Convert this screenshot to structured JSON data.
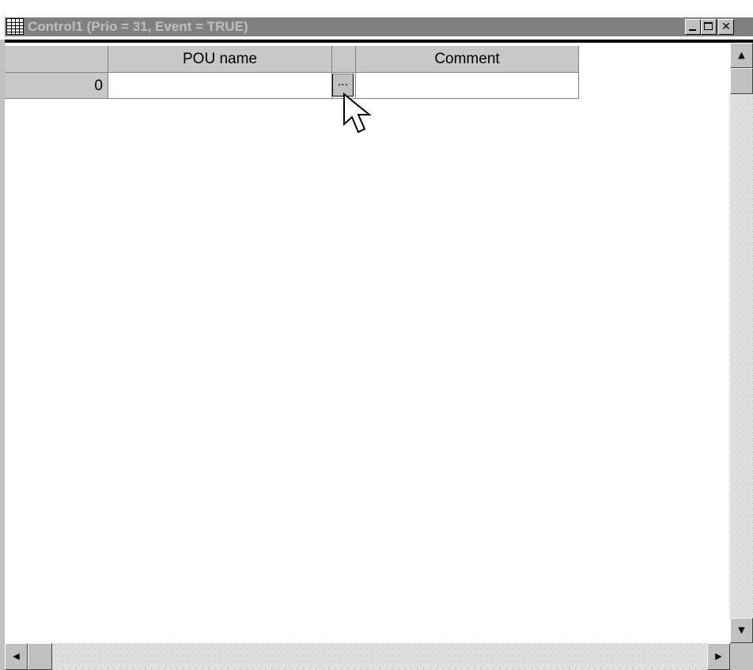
{
  "window": {
    "title": "Control1 (Prio = 31, Event = TRUE)",
    "icon": "table-grid-icon",
    "buttons": {
      "minimize": "minimize-icon",
      "maximize": "maximize-icon",
      "close": "✕"
    }
  },
  "table": {
    "columns": [
      {
        "label": ""
      },
      {
        "label": "POU name"
      },
      {
        "label": ""
      },
      {
        "label": "Comment"
      }
    ],
    "rows": [
      {
        "index": "0",
        "pou_name": "",
        "comment": ""
      }
    ],
    "browse_button_label": "..."
  },
  "scrollbars": {
    "up": "▲",
    "down": "▼",
    "left": "◀",
    "right": "▶"
  }
}
